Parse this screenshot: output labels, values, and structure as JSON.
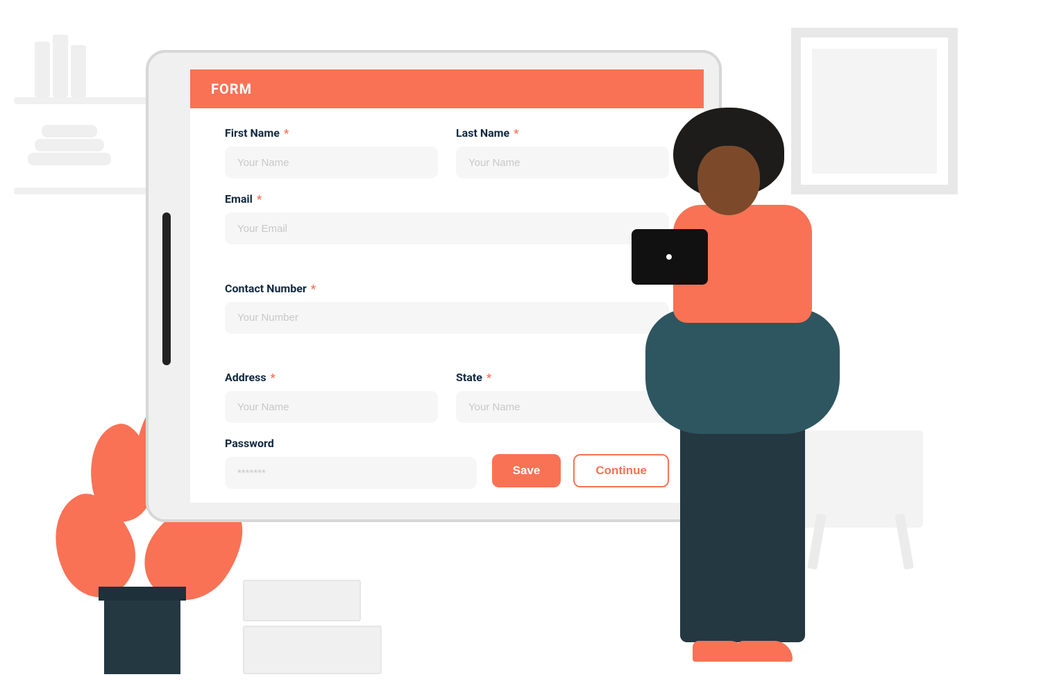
{
  "header": {
    "title": "FORM"
  },
  "fields": {
    "first_name": {
      "label": "First Name",
      "required": true,
      "placeholder": "Your Name",
      "value": ""
    },
    "last_name": {
      "label": "Last Name",
      "required": true,
      "placeholder": "Your Name",
      "value": ""
    },
    "email": {
      "label": "Email",
      "required": true,
      "placeholder": "Your Email",
      "value": ""
    },
    "contact": {
      "label": "Contact  Number",
      "required": true,
      "placeholder": "Your Number",
      "value": ""
    },
    "address": {
      "label": "Address",
      "required": true,
      "placeholder": "Your Name",
      "value": ""
    },
    "state": {
      "label": "State",
      "required": true,
      "placeholder": "Your Name",
      "value": ""
    },
    "password": {
      "label": "Password",
      "required": false,
      "placeholder": "*******",
      "value": ""
    }
  },
  "buttons": {
    "save": "Save",
    "continue": "Continue"
  },
  "required_mark": "*",
  "colors": {
    "accent": "#f97255",
    "text": "#102840",
    "input_bg": "#f6f6f6"
  }
}
